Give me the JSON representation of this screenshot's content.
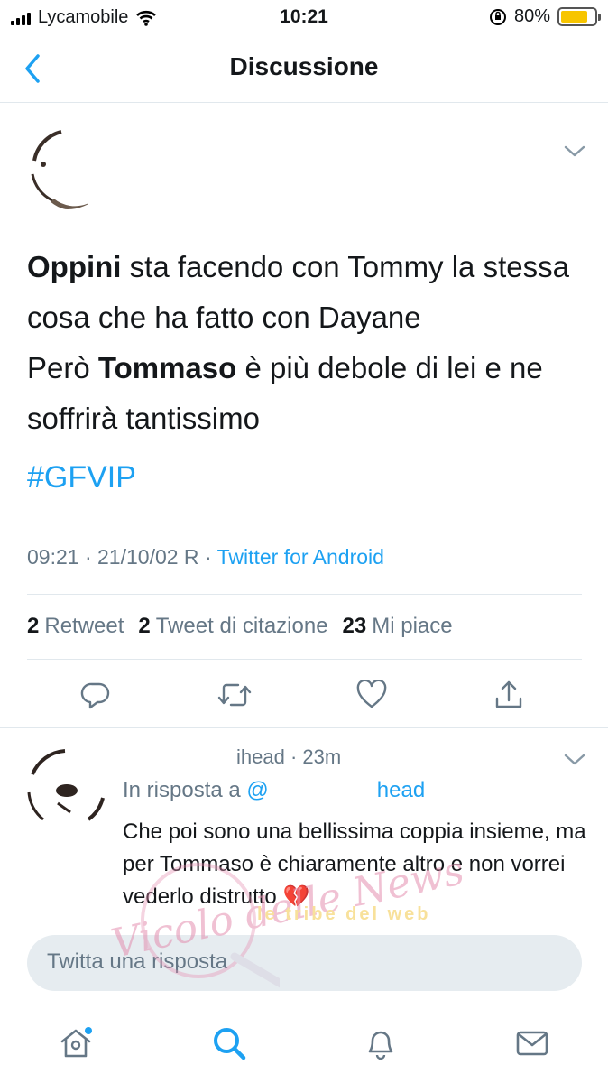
{
  "status_bar": {
    "carrier": "Lycamobile",
    "time": "10:21",
    "battery_percent": "80%",
    "battery_level": 0.8,
    "battery_color": "#f7c500"
  },
  "nav": {
    "back_icon": "chevron-left-icon",
    "title": "Discussione"
  },
  "tweet": {
    "text_line1_bold": "Oppini",
    "text_line1_rest": " sta facendo con Tommy la stessa cosa che ha fatto con Dayane",
    "text_line2_start": "Però ",
    "text_line2_bold": "Tommaso",
    "text_line2_rest": " è più debole di lei e ne soffrirà tantissimo",
    "hashtag": "#GFVIP",
    "time": "09:21",
    "date": "21/10/02 R",
    "separator": "·",
    "source": "Twitter for Android",
    "stats": {
      "retweets_count": "2",
      "retweets_label": "Retweet",
      "quotes_count": "2",
      "quotes_label": "Tweet di citazione",
      "likes_count": "23",
      "likes_label": "Mi piace"
    }
  },
  "reply": {
    "handle_fragment": "ihead · 23m",
    "in_reply_prefix": "In risposta a",
    "in_reply_handle": "@",
    "in_reply_handle_tail": "head",
    "text": "Che poi sono una bellissima coppia insieme, ma per Tommaso è chiaramente altro e non vorrei vederlo distrutto",
    "emoji": "💔"
  },
  "compose": {
    "placeholder": "Twitta una risposta"
  },
  "tabs": [
    "home-icon",
    "search-icon",
    "notifications-icon",
    "messages-icon"
  ],
  "colors": {
    "accent": "#1da1f2",
    "secondary_text": "#657786",
    "divider": "#e1e8ed"
  },
  "watermark": {
    "script": "Vicolo delle News",
    "brand": "le tribe del web"
  }
}
